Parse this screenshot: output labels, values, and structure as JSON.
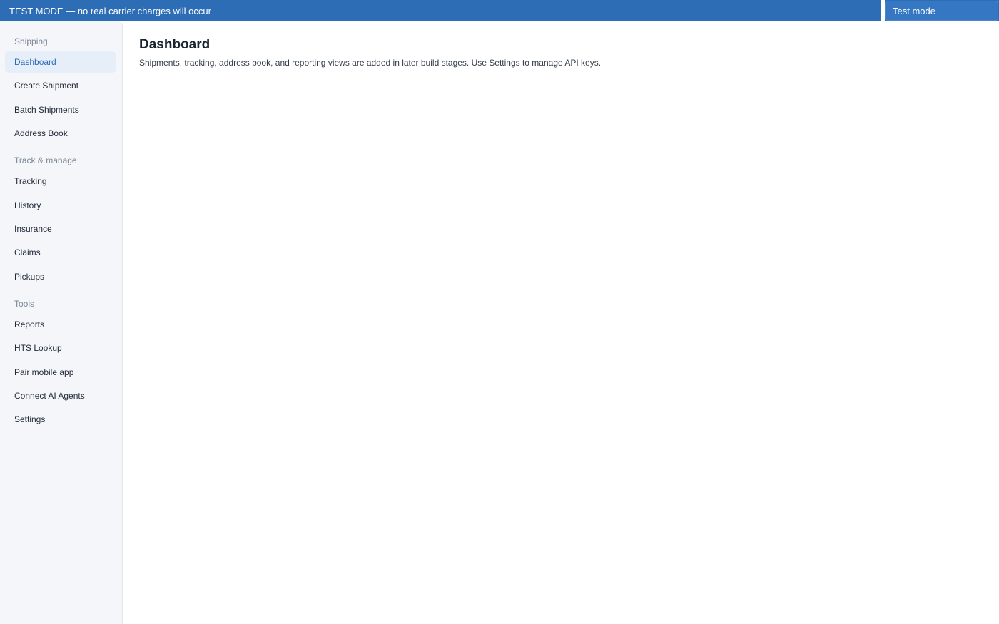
{
  "banner": {
    "text": "TEST MODE — no real carrier charges will occur",
    "mode_button_label": "Test mode",
    "color": "#2d6db5"
  },
  "sidebar": {
    "sections": [
      {
        "title": "Shipping",
        "items": [
          {
            "label": "Dashboard",
            "active": true
          },
          {
            "label": "Create Shipment"
          },
          {
            "label": "Batch Shipments"
          },
          {
            "label": "Address Book"
          }
        ]
      },
      {
        "title": "Track & manage",
        "items": [
          {
            "label": "Tracking"
          },
          {
            "label": "History"
          },
          {
            "label": "Insurance"
          },
          {
            "label": "Claims"
          },
          {
            "label": "Pickups"
          }
        ]
      },
      {
        "title": "Tools",
        "items": [
          {
            "label": "Reports"
          },
          {
            "label": "HTS Lookup"
          },
          {
            "label": "Pair mobile app"
          },
          {
            "label": "Connect AI Agents"
          },
          {
            "label": "Settings"
          }
        ]
      }
    ]
  },
  "main": {
    "title": "Dashboard",
    "description": "Shipments, tracking, address book, and reporting views are added in later build stages. Use Settings to manage API keys."
  }
}
